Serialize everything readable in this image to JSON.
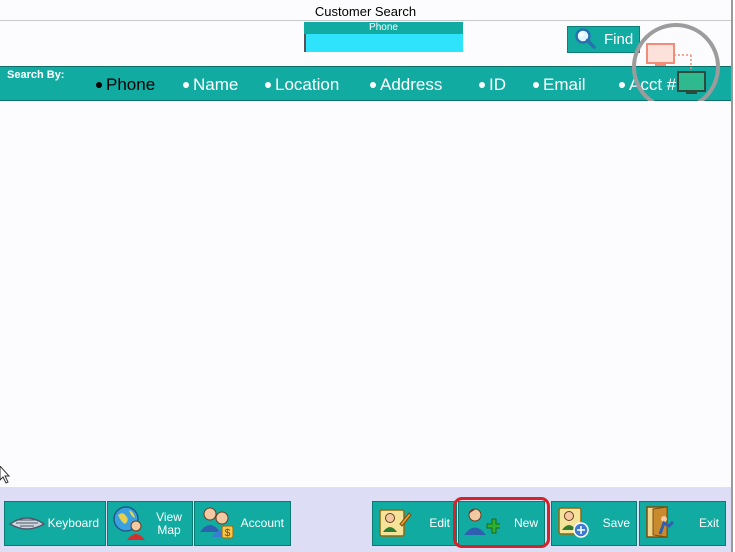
{
  "window": {
    "title": "Customer Search"
  },
  "phone": {
    "label": "Phone",
    "value": ""
  },
  "find_button": {
    "label": "Find"
  },
  "search_by": {
    "label": "Search By:",
    "options": [
      {
        "label": "Phone",
        "selected": true
      },
      {
        "label": "Name",
        "selected": false
      },
      {
        "label": "Location",
        "selected": false
      },
      {
        "label": "Address",
        "selected": false
      },
      {
        "label": "ID",
        "selected": false
      },
      {
        "label": "Email",
        "selected": false
      },
      {
        "label": "Acct #",
        "selected": false
      }
    ]
  },
  "toolbar": {
    "keyboard": "Keyboard",
    "view_map": "View Map",
    "account": "Account",
    "edit": "Edit",
    "new": "New",
    "save": "Save",
    "exit": "Exit"
  },
  "colors": {
    "teal": "#12aba2",
    "input_cyan": "#2ee3fb",
    "highlight_red": "#d4242a",
    "bottom_bar": "#ddddf6"
  },
  "icons": {
    "find": "magnifier-icon",
    "keyboard": "keyboard-icon",
    "view_map": "globe-user-icon",
    "account": "account-users-icon",
    "edit": "edit-user-icon",
    "new": "new-user-icon",
    "save": "save-user-icon",
    "exit": "exit-door-icon",
    "overlay": "remote-monitor-icon"
  }
}
